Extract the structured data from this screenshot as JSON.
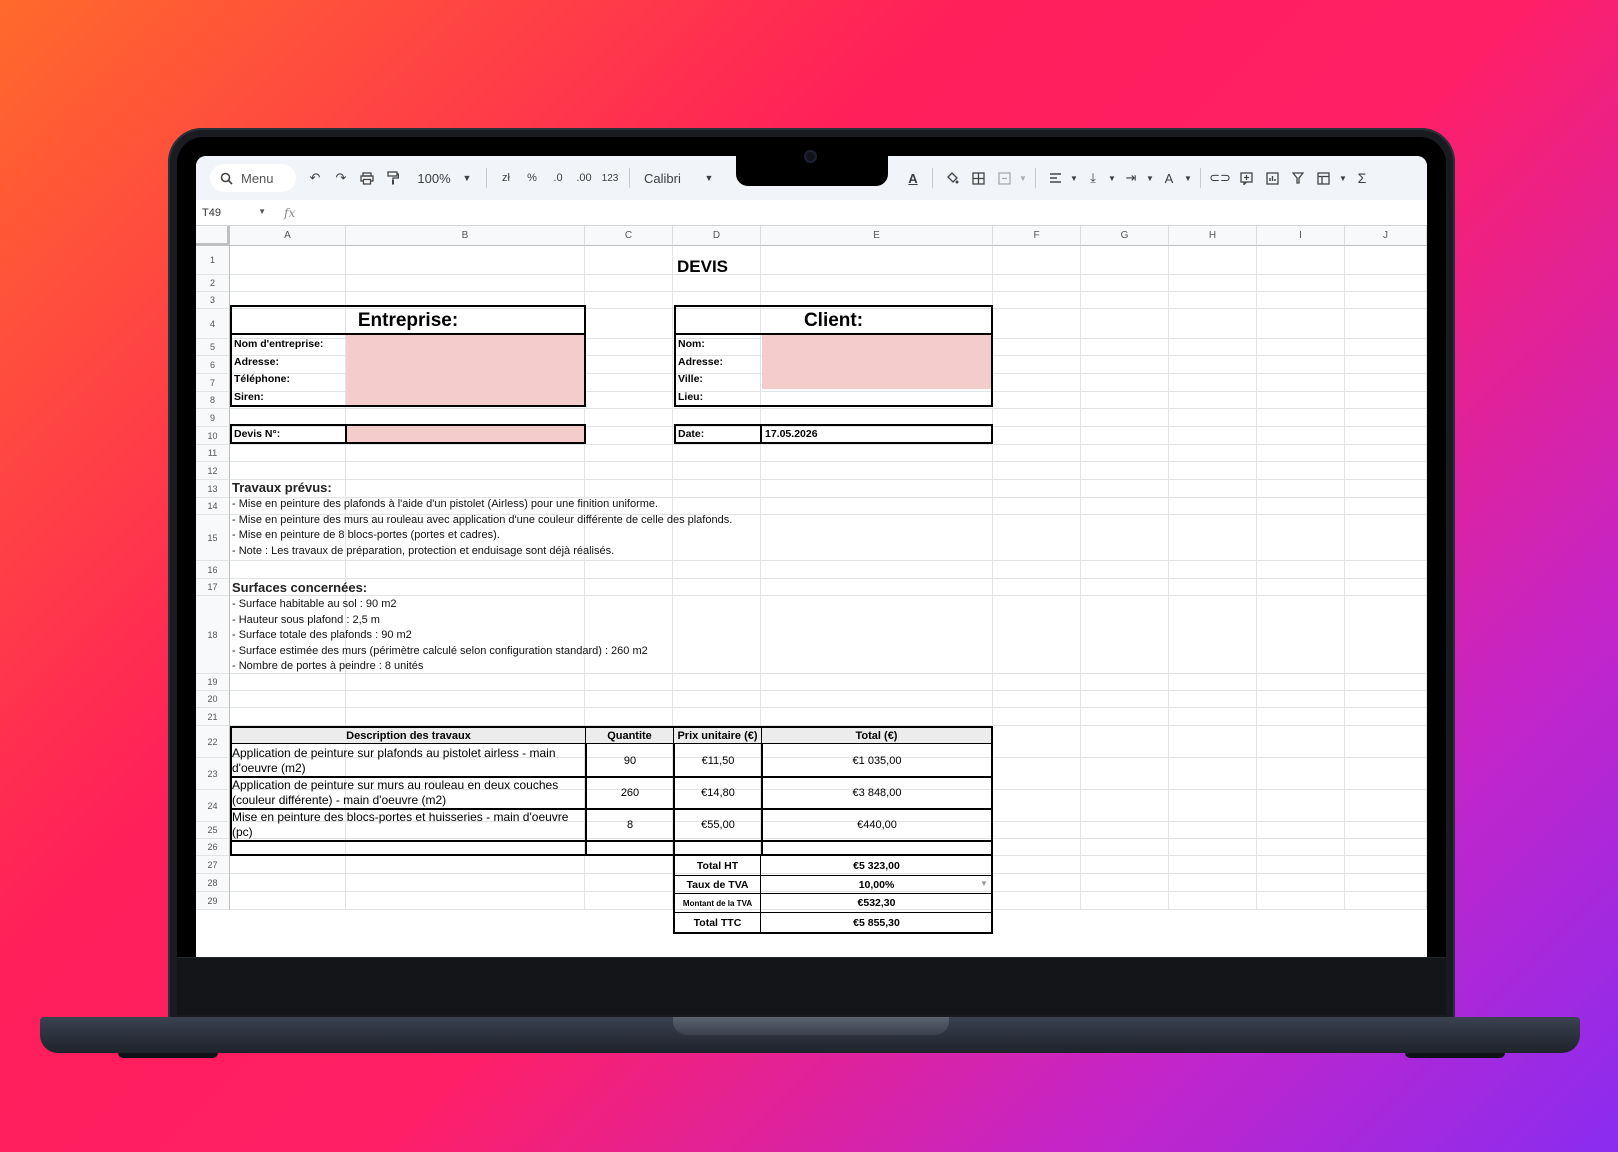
{
  "toolbar": {
    "menu_label": "Menu",
    "zoom": "100%",
    "currency": "zł",
    "percent": "%",
    "dec_decrease": ".0",
    "dec_increase": ".00",
    "number_format": "123",
    "font": "Calibri",
    "sum_icon": "Σ"
  },
  "formula_bar": {
    "cell_ref": "T49",
    "fx": "fx"
  },
  "columns": [
    "A",
    "B",
    "C",
    "D",
    "E",
    "F",
    "G",
    "H",
    "I",
    "J"
  ],
  "rows": [
    "1",
    "2",
    "3",
    "4",
    "5",
    "6",
    "7",
    "8",
    "9",
    "10",
    "11",
    "12",
    "13",
    "14",
    "15",
    "16",
    "17",
    "18",
    "19",
    "20",
    "21",
    "22",
    "23",
    "24",
    "25",
    "26",
    "27",
    "28",
    "29"
  ],
  "sheet": {
    "title": "DEVIS",
    "entreprise": {
      "heading": "Entreprise:",
      "labels": [
        "Nom d'entreprise:",
        "Adresse:",
        "Téléphone:",
        "Siren:"
      ]
    },
    "client": {
      "heading": "Client:",
      "labels": [
        "Nom:",
        "Adresse:",
        "Ville:",
        "Lieu:"
      ]
    },
    "devis_label": "Devis N°:",
    "date_label": "Date:",
    "date_value": "17.05.2026",
    "travaux_title": "Travaux prévus:",
    "travaux_lines": [
      "- Mise en peinture des plafonds à l'aide d'un pistolet (Airless) pour une finition uniforme.",
      "- Mise en peinture des murs au rouleau avec application d'une couleur différente de celle des plafonds.",
      "- Mise en peinture de 8 blocs-portes (portes et cadres).",
      "- Note : Les travaux de préparation, protection et enduisage sont déjà réalisés."
    ],
    "surfaces_title": "Surfaces concernées:",
    "surfaces_lines": [
      "- Surface habitable au sol : 90 m2",
      "- Hauteur sous plafond : 2,5 m",
      "- Surface totale des plafonds : 90 m2",
      "- Surface estimée des murs (périmètre calculé selon configuration standard) : 260 m2",
      "- Nombre de portes à peindre : 8 unités"
    ],
    "table_headers": [
      "Description des travaux",
      "Quantite",
      "Prix unitaire (€)",
      "Total (€)"
    ],
    "table_rows": [
      {
        "desc": "Application de peinture sur plafonds au pistolet airless - main d'oeuvre (m2)",
        "qty": "90",
        "unit": "€11,50",
        "total": "€1 035,00"
      },
      {
        "desc": "Application de peinture sur murs au rouleau en deux couches (couleur différente) - main d'oeuvre (m2)",
        "qty": "260",
        "unit": "€14,80",
        "total": "€3 848,00"
      },
      {
        "desc": "Mise en peinture des blocs-portes et huisseries - main d'oeuvre (pc)",
        "qty": "8",
        "unit": "€55,00",
        "total": "€440,00"
      }
    ],
    "totals": {
      "ht_label": "Total HT",
      "ht_value": "€5 323,00",
      "tva_rate_label": "Taux de TVA",
      "tva_rate_value": "10,00%",
      "tva_amount_label": "Montant de la TVA",
      "tva_amount_value": "€532,30",
      "ttc_label": "Total TTC",
      "ttc_value": "€5 855,30"
    }
  },
  "colors": {
    "pink_fill": "#f4cccc",
    "header_fill": "#ececec",
    "bg_gradient_start": "#ff6a2b",
    "bg_gradient_end": "#8a2cf0"
  }
}
